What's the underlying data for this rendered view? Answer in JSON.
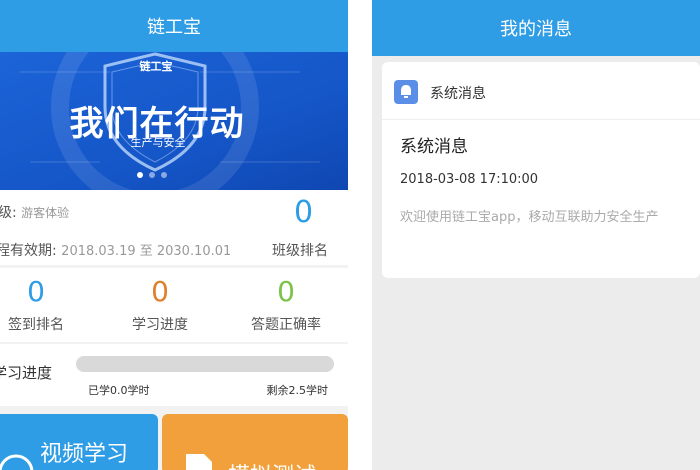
{
  "left": {
    "title": "链工宝",
    "banner": {
      "shield_text": "链工宝",
      "headline": "我们在行动",
      "subline": "生产与安全"
    },
    "info": {
      "class_label": "级:",
      "class_value": "游客体验",
      "validity_label": "程有效期:",
      "validity_value": "2018.03.19 至 2030.10.01",
      "class_rank_value": "0",
      "class_rank_label": "班级排名"
    },
    "stats": [
      {
        "value": "0",
        "label": "签到排名",
        "color": "#2f9de6"
      },
      {
        "value": "0",
        "label": "学习进度",
        "color": "#e0802a"
      },
      {
        "value": "0",
        "label": "答题正确率",
        "color": "#7cc34a"
      }
    ],
    "progress": {
      "label": "学习进度",
      "fraction": 0.0,
      "done": "已学0.0学时",
      "remaining": "剩余2.5学时"
    },
    "cards": {
      "video": "视频学习",
      "exam": "模拟测试"
    }
  },
  "right": {
    "title": "我的消息",
    "section": "系统消息",
    "message": {
      "title": "系统消息",
      "time": "2018-03-08 17:10:00",
      "body": "欢迎使用链工宝app，移动互联助力安全生产"
    }
  }
}
